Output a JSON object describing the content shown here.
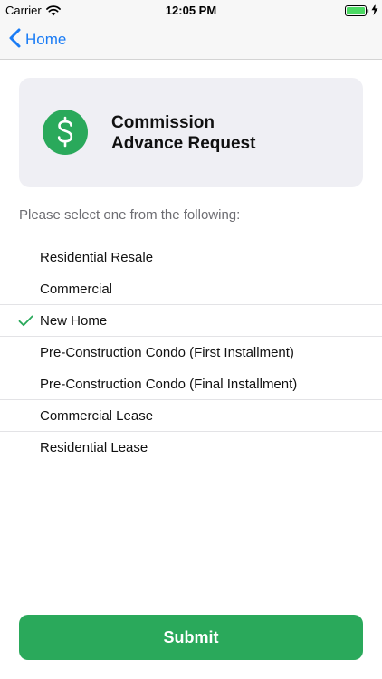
{
  "status_bar": {
    "carrier": "Carrier",
    "time": "12:05 PM"
  },
  "nav": {
    "back_label": "Home"
  },
  "card": {
    "title_line1": "Commission",
    "title_line2": "Advance Request",
    "icon": "dollar-icon",
    "icon_color": "#2aa95b"
  },
  "prompt": "Please select one from the following:",
  "options": [
    {
      "label": "Residential Resale",
      "selected": false
    },
    {
      "label": "Commercial",
      "selected": false
    },
    {
      "label": "New Home",
      "selected": true
    },
    {
      "label": "Pre-Construction Condo (First Installment)",
      "selected": false
    },
    {
      "label": "Pre-Construction Condo (Final Installment)",
      "selected": false
    },
    {
      "label": "Commercial Lease",
      "selected": false
    },
    {
      "label": "Residential Lease",
      "selected": false
    }
  ],
  "submit_label": "Submit",
  "colors": {
    "accent_blue": "#1a7cf5",
    "brand_green": "#2aa95b"
  }
}
